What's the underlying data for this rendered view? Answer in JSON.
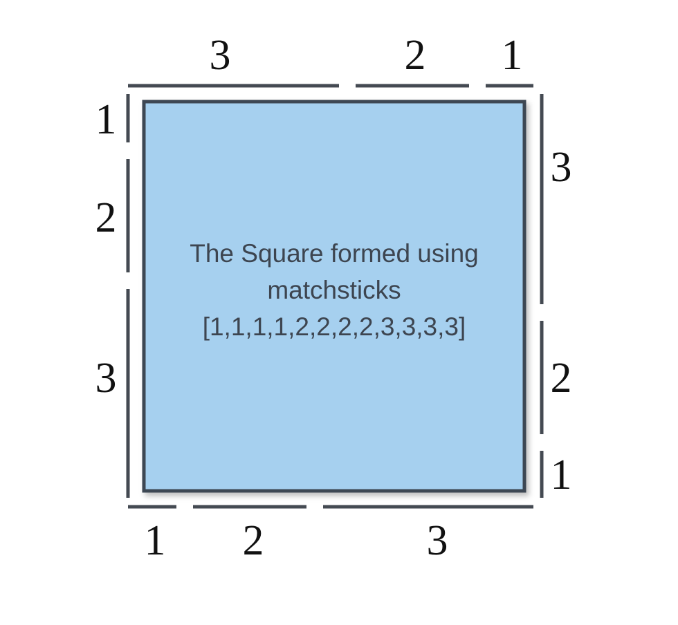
{
  "square": {
    "caption_line1": "The Square formed using",
    "caption_line2": "matchsticks",
    "caption_line3": "[1,1,1,1,2,2,2,2,3,3,3,3]",
    "fill_color": "#a6d0ef",
    "border_color": "#3e4652"
  },
  "stick_color": "#444a52",
  "sides": {
    "top": [
      "3",
      "2",
      "1"
    ],
    "right": [
      "3",
      "2",
      "1"
    ],
    "bottom": [
      "1",
      "2",
      "3"
    ],
    "left": [
      "1",
      "2",
      "3"
    ]
  }
}
